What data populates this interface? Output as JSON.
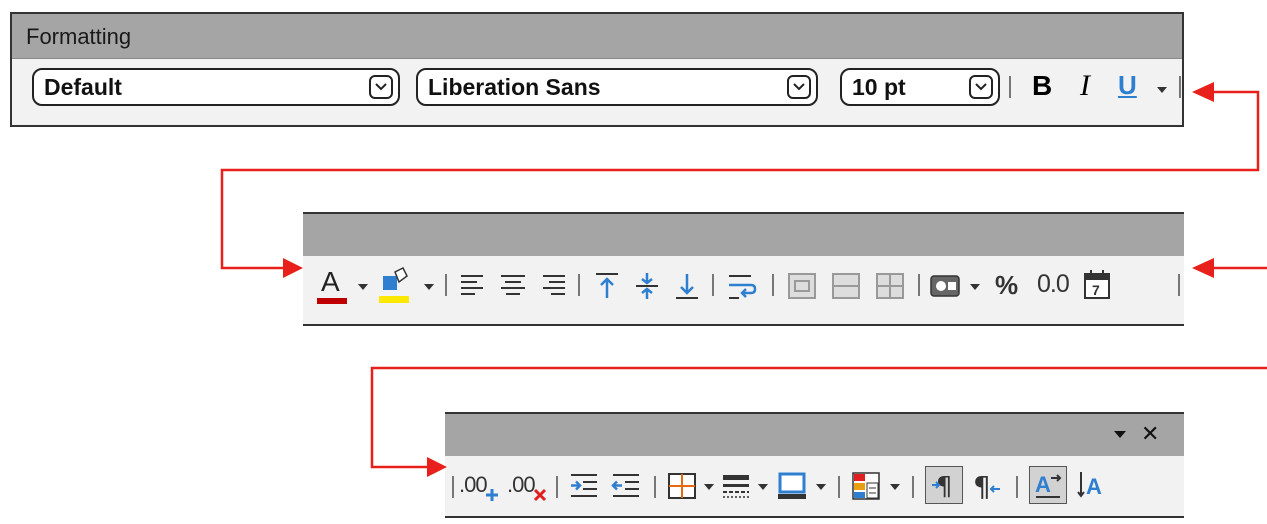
{
  "formatting_toolbar": {
    "title": "Formatting",
    "style_combo": "Default",
    "font_combo": "Liberation Sans",
    "size_combo": "10 pt",
    "bold_label": "B",
    "italic_label": "I",
    "underline_label": "U"
  },
  "toolbar_row2": {
    "font_color_label": "A",
    "percent_label": "%",
    "decimal_label": "0.0"
  },
  "toolbar_row3": {
    "add_decimal_label": ".00",
    "delete_decimal_label": ".00",
    "close_label": "✕"
  },
  "colors": {
    "titlebar": "#a5a5a5",
    "toolbar_bg": "#f2f2f2",
    "arrow": "#e8201c",
    "font_color_red": "#c00000",
    "highlight_yellow": "#ffe800",
    "icon_blue": "#2f7fd0"
  }
}
